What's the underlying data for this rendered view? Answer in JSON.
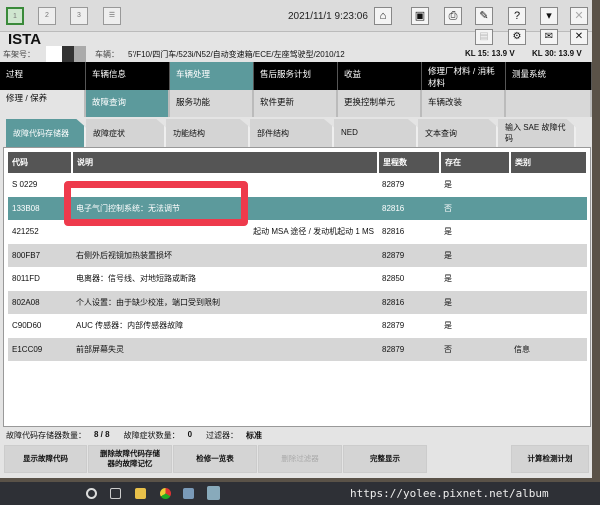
{
  "topbar": {
    "tabs": [
      "1",
      "2",
      "3"
    ],
    "datetime": "2021/11/1 9:23:06"
  },
  "header": {
    "app_title": "ISTA",
    "vin_label": "车架号：",
    "vehicle_label": "车辆：",
    "vehicle": "5'/F10/四门车/523i/N52/自动变速箱/ECE/左座驾驶型/2010/12",
    "kl15": "KL 15:  13.9 V",
    "kl30": "KL 30:  13.9 V"
  },
  "menu1": [
    "过程",
    "车辆信息",
    "车辆处理",
    "售后服务计划",
    "收益",
    "修理厂材料 / 消耗材料",
    "测量系统"
  ],
  "menu2": [
    "修理 / 保养",
    "故障查询",
    "服务功能",
    "软件更新",
    "更换控制单元",
    "车辆改装",
    ""
  ],
  "tabs": [
    "故障代码存储器",
    "故障症状",
    "功能结构",
    "部件结构",
    "NED",
    "文本查询",
    "输入 SAE 故障代码"
  ],
  "table": {
    "headers": [
      "代码",
      "说明",
      "里程数",
      "存在",
      "类别"
    ],
    "rows": [
      [
        "S 0229",
        "",
        "82879",
        "是",
        ""
      ],
      [
        "133B08",
        "电子气门控制系统：无法调节",
        "82816",
        "否",
        ""
      ],
      [
        "421252",
        "起动 MSA 途径 / 发动机起动 1 MS",
        "82816",
        "是",
        ""
      ],
      [
        "800FB7",
        "右侧外后视镜加热装置损坏",
        "82879",
        "是",
        ""
      ],
      [
        "8011FD",
        "电离器：信号线、对地短路或断路",
        "82850",
        "是",
        ""
      ],
      [
        "802A08",
        "个人设置：由于缺少校准，端口受到限制",
        "82816",
        "是",
        ""
      ],
      [
        "C90D60",
        "AUC 传感器：内部传感器故障",
        "82879",
        "是",
        ""
      ],
      [
        "E1CC09",
        "前部屏幕失灵",
        "82879",
        "否",
        "信息"
      ]
    ]
  },
  "status": {
    "dtc_label": "故障代码存储器数量：",
    "dtc_value": "8 / 8",
    "sym_label": "故障症状数量：",
    "sym_value": "0",
    "filter_label": "过滤器：",
    "filter_value": "标准"
  },
  "buttons": [
    "显示故障代码",
    "删除故障代码存储器的故障记忆",
    "检修一览表",
    "删除过滤器",
    "完整显示",
    "计算检测计划"
  ],
  "watermark": "https://yolee.pixnet.net/album"
}
